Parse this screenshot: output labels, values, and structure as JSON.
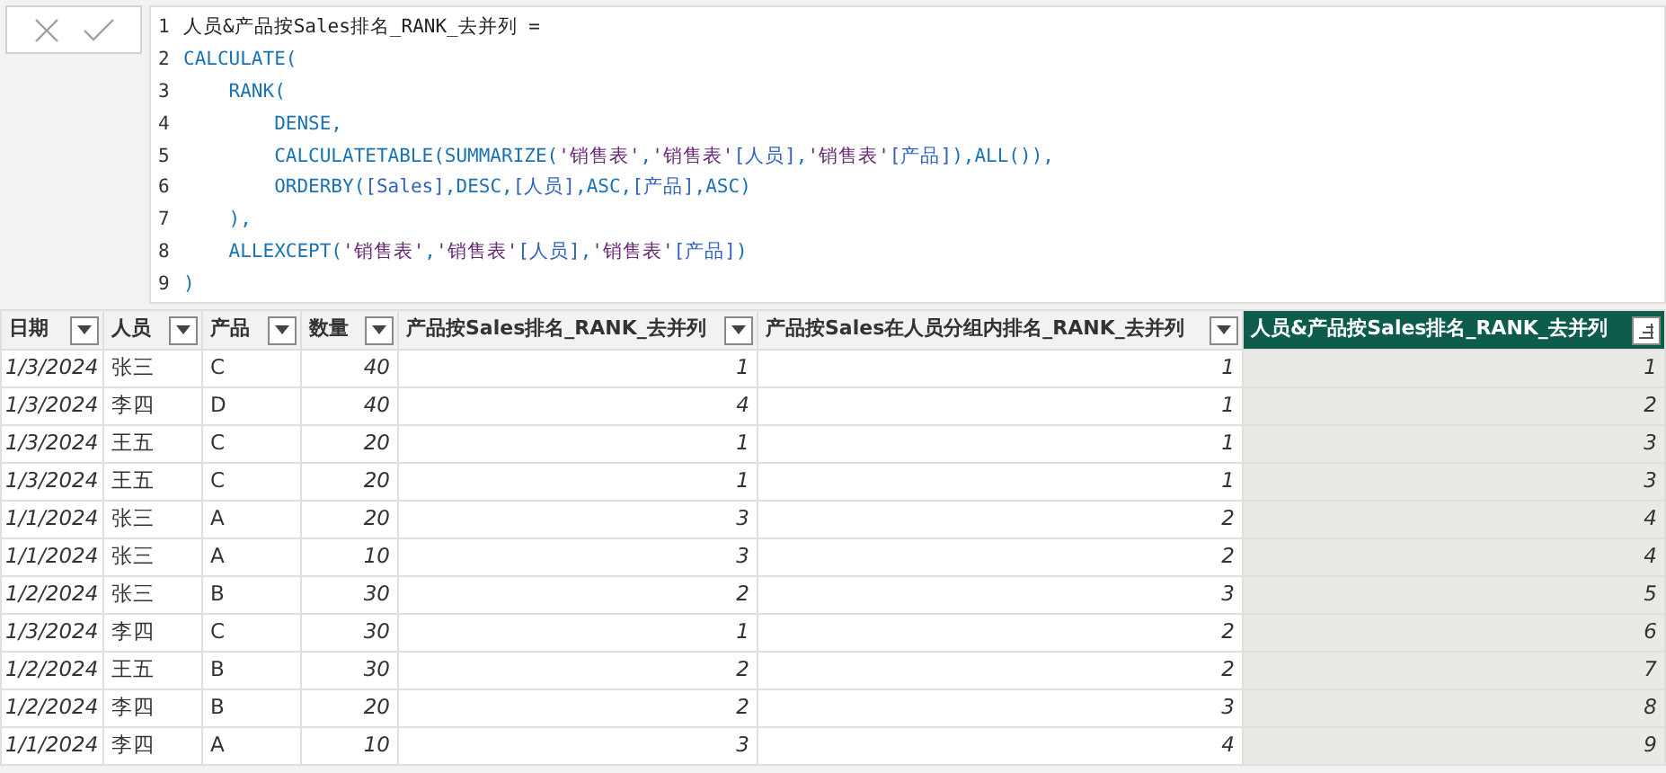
{
  "formula_bar": {
    "lines": [
      {
        "number": "1",
        "tokens": [
          {
            "kind": "plain",
            "text": "人员&产品按Sales排名_RANK_去并列 ="
          }
        ]
      },
      {
        "number": "2",
        "tokens": [
          {
            "kind": "fn",
            "text": "CALCULATE("
          }
        ]
      },
      {
        "number": "3",
        "tokens": [
          {
            "kind": "fn",
            "text": "    RANK("
          }
        ]
      },
      {
        "number": "4",
        "tokens": [
          {
            "kind": "fn",
            "text": "        DENSE,"
          }
        ]
      },
      {
        "number": "5",
        "tokens": [
          {
            "kind": "fn",
            "text": "        CALCULATETABLE(SUMMARIZE("
          },
          {
            "kind": "str",
            "text": "'销售表'"
          },
          {
            "kind": "fn",
            "text": ","
          },
          {
            "kind": "str",
            "text": "'销售表'"
          },
          {
            "kind": "col",
            "text": "[人员]"
          },
          {
            "kind": "fn",
            "text": ","
          },
          {
            "kind": "str",
            "text": "'销售表'"
          },
          {
            "kind": "col",
            "text": "[产品]"
          },
          {
            "kind": "fn",
            "text": "),ALL()),"
          }
        ]
      },
      {
        "number": "6",
        "tokens": [
          {
            "kind": "fn",
            "text": "        ORDERBY("
          },
          {
            "kind": "col",
            "text": "[Sales]"
          },
          {
            "kind": "fn",
            "text": ",DESC,"
          },
          {
            "kind": "col",
            "text": "[人员]"
          },
          {
            "kind": "fn",
            "text": ",ASC,"
          },
          {
            "kind": "col",
            "text": "[产品]"
          },
          {
            "kind": "fn",
            "text": ",ASC)"
          }
        ]
      },
      {
        "number": "7",
        "tokens": [
          {
            "kind": "fn",
            "text": "    ),"
          }
        ]
      },
      {
        "number": "8",
        "tokens": [
          {
            "kind": "fn",
            "text": "    ALLEXCEPT("
          },
          {
            "kind": "str",
            "text": "'销售表'"
          },
          {
            "kind": "fn",
            "text": ","
          },
          {
            "kind": "str",
            "text": "'销售表'"
          },
          {
            "kind": "col",
            "text": "[人员]"
          },
          {
            "kind": "fn",
            "text": ","
          },
          {
            "kind": "str",
            "text": "'销售表'"
          },
          {
            "kind": "col",
            "text": "[产品]"
          },
          {
            "kind": "fn",
            "text": ")"
          }
        ]
      },
      {
        "number": "9",
        "tokens": [
          {
            "kind": "fn",
            "text": ")"
          }
        ]
      }
    ]
  },
  "table": {
    "columns": [
      {
        "label": "日期",
        "kind": "date",
        "selected": false
      },
      {
        "label": "人员",
        "kind": "text",
        "selected": false
      },
      {
        "label": "产品",
        "kind": "text",
        "selected": false
      },
      {
        "label": "数量",
        "kind": "number",
        "selected": false
      },
      {
        "label": "产品按Sales排名_RANK_去并列",
        "kind": "number",
        "selected": false
      },
      {
        "label": "产品按Sales在人员分组内排名_RANK_去并列",
        "kind": "number",
        "selected": false
      },
      {
        "label": "人员&产品按Sales排名_RANK_去并列",
        "kind": "number",
        "selected": true
      }
    ],
    "rows": [
      [
        "1/3/2024",
        "张三",
        "C",
        "40",
        "1",
        "1",
        "1"
      ],
      [
        "1/3/2024",
        "李四",
        "D",
        "40",
        "4",
        "1",
        "2"
      ],
      [
        "1/3/2024",
        "王五",
        "C",
        "20",
        "1",
        "1",
        "3"
      ],
      [
        "1/3/2024",
        "王五",
        "C",
        "20",
        "1",
        "1",
        "3"
      ],
      [
        "1/1/2024",
        "张三",
        "A",
        "20",
        "3",
        "2",
        "4"
      ],
      [
        "1/1/2024",
        "张三",
        "A",
        "10",
        "3",
        "2",
        "4"
      ],
      [
        "1/2/2024",
        "张三",
        "B",
        "30",
        "2",
        "3",
        "5"
      ],
      [
        "1/3/2024",
        "李四",
        "C",
        "30",
        "1",
        "2",
        "6"
      ],
      [
        "1/2/2024",
        "王五",
        "B",
        "30",
        "2",
        "2",
        "7"
      ],
      [
        "1/2/2024",
        "李四",
        "B",
        "20",
        "2",
        "3",
        "8"
      ],
      [
        "1/1/2024",
        "李四",
        "A",
        "10",
        "3",
        "4",
        "9"
      ]
    ]
  }
}
